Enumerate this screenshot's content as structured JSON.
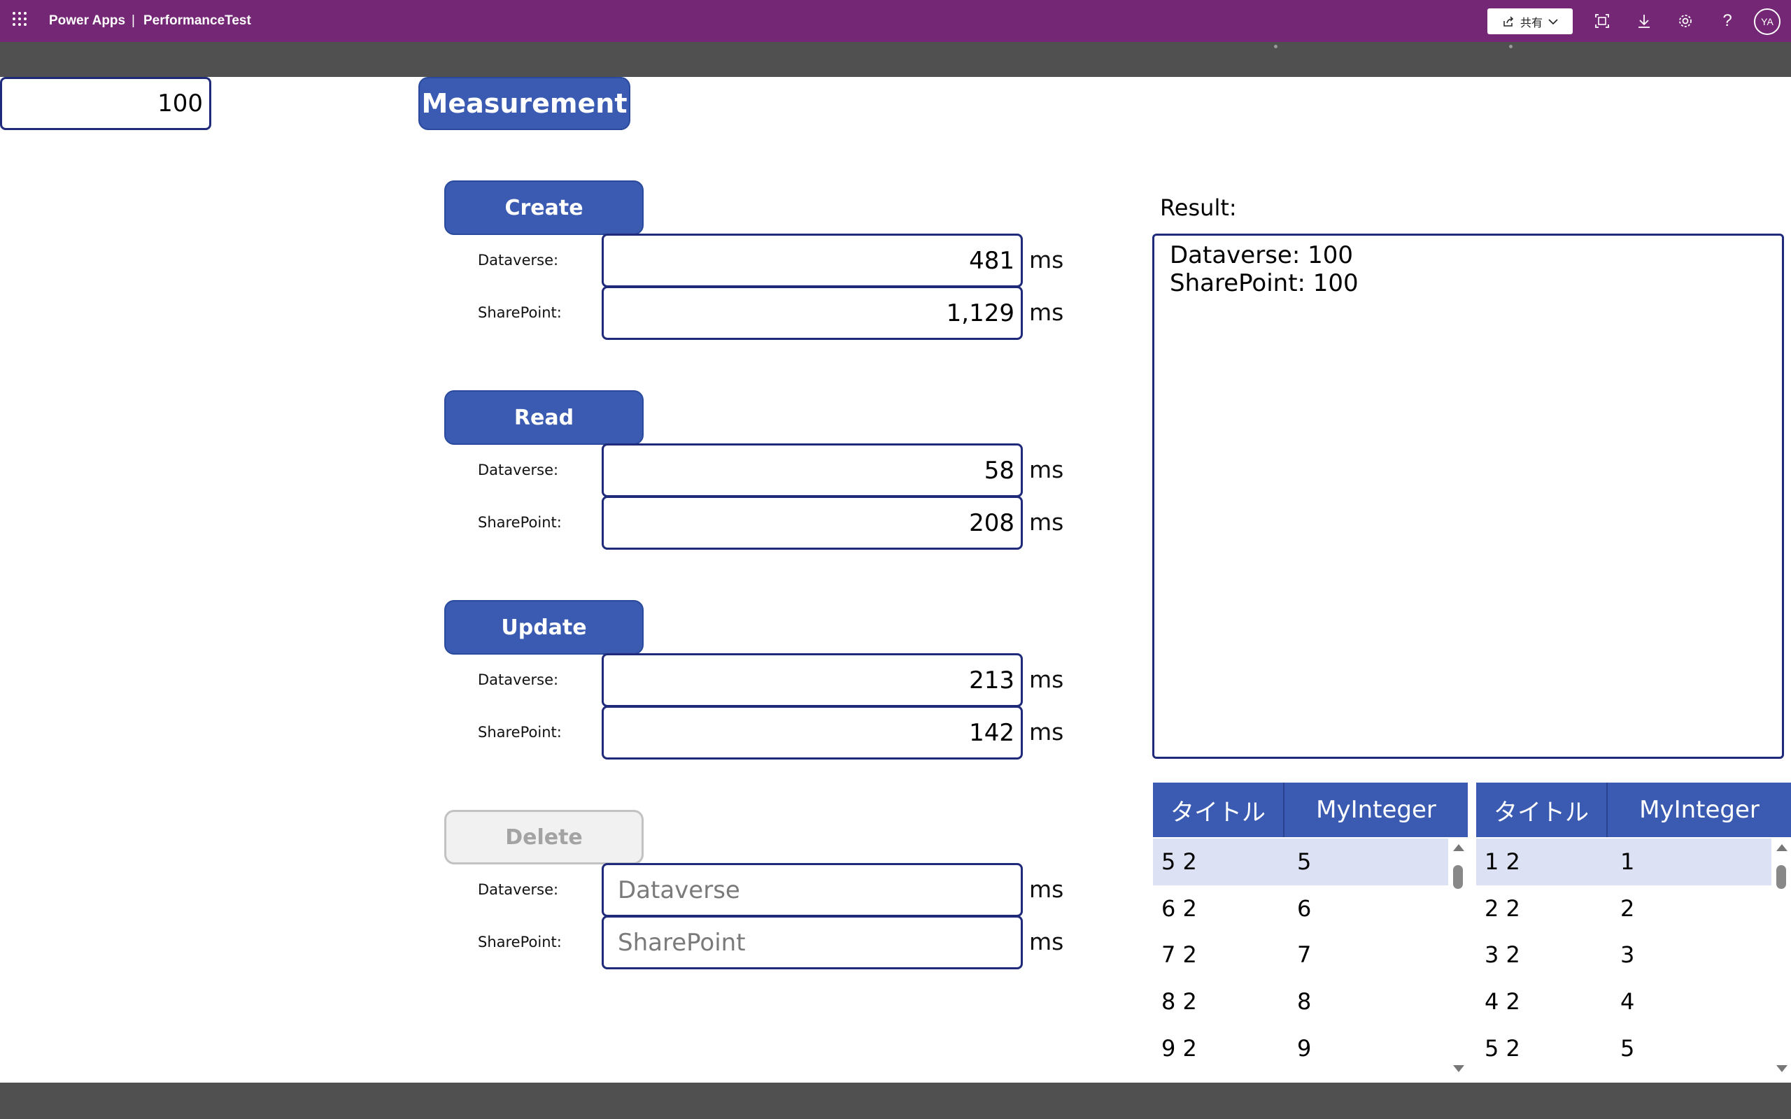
{
  "app": {
    "name": "Power Apps",
    "separator": "|",
    "title": "PerformanceTest",
    "share_label": "共有",
    "user_initials": "YA"
  },
  "count_field": {
    "value": "100"
  },
  "measurement_button": "Measurement",
  "unit_label": "ms",
  "dataverse_label": "Dataverse:",
  "sharepoint_label": "SharePoint:",
  "sections": {
    "create": {
      "button": "Create",
      "dataverse": "481",
      "sharepoint": "1,129"
    },
    "read": {
      "button": "Read",
      "dataverse": "58",
      "sharepoint": "208"
    },
    "update": {
      "button": "Update",
      "dataverse": "213",
      "sharepoint": "142"
    },
    "delete": {
      "button": "Delete",
      "dataverse_placeholder": "Dataverse",
      "sharepoint_placeholder": "SharePoint"
    }
  },
  "result": {
    "label": "Result:",
    "line1": "Dataverse: 100",
    "line2": "SharePoint: 100"
  },
  "tables": {
    "left": {
      "headers": [
        "タイトル",
        "MyInteger"
      ],
      "rows": [
        [
          "5 2",
          "5"
        ],
        [
          "6 2",
          "6"
        ],
        [
          "7 2",
          "7"
        ],
        [
          "8 2",
          "8"
        ],
        [
          "9 2",
          "9"
        ]
      ]
    },
    "right": {
      "headers": [
        "タイトル",
        "MyInteger"
      ],
      "rows": [
        [
          "1 2",
          "1"
        ],
        [
          "2 2",
          "2"
        ],
        [
          "3 2",
          "3"
        ],
        [
          "4 2",
          "4"
        ],
        [
          "5 2",
          "5"
        ]
      ]
    }
  },
  "colors": {
    "topbar": "#742774",
    "button": "#3a5bb1",
    "field_border": "#1f2a7a",
    "selected_row": "#dce1f3"
  }
}
